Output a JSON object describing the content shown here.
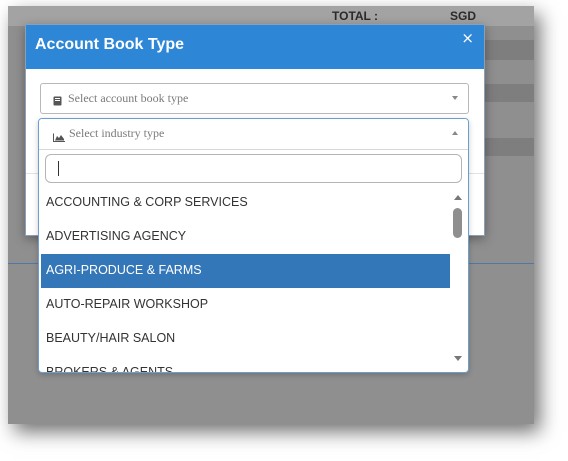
{
  "background": {
    "total_label": "TOTAL :",
    "currency": "SGD"
  },
  "modal": {
    "title": "Account Book Type",
    "close_glyph": "×",
    "account_book_select": {
      "placeholder": "Select account book type",
      "icon": "book-icon"
    },
    "industry_select": {
      "placeholder": "Select industry type",
      "icon": "area-chart-icon",
      "state": "open"
    }
  },
  "dropdown": {
    "search_value": "",
    "options": [
      "ACCOUNTING & CORP SERVICES",
      "ADVERTISING AGENCY",
      "AGRI-PRODUCE & FARMS",
      "AUTO-REPAIR WORKSHOP",
      "BEAUTY/HAIR SALON",
      "BROKERS & AGENTS"
    ],
    "selected": "AGRI-PRODUCE & FARMS"
  },
  "colors": {
    "header_blue": "#2e86d6",
    "highlight_blue": "#3477b8",
    "overlay_gray": "#8f8f8f"
  }
}
